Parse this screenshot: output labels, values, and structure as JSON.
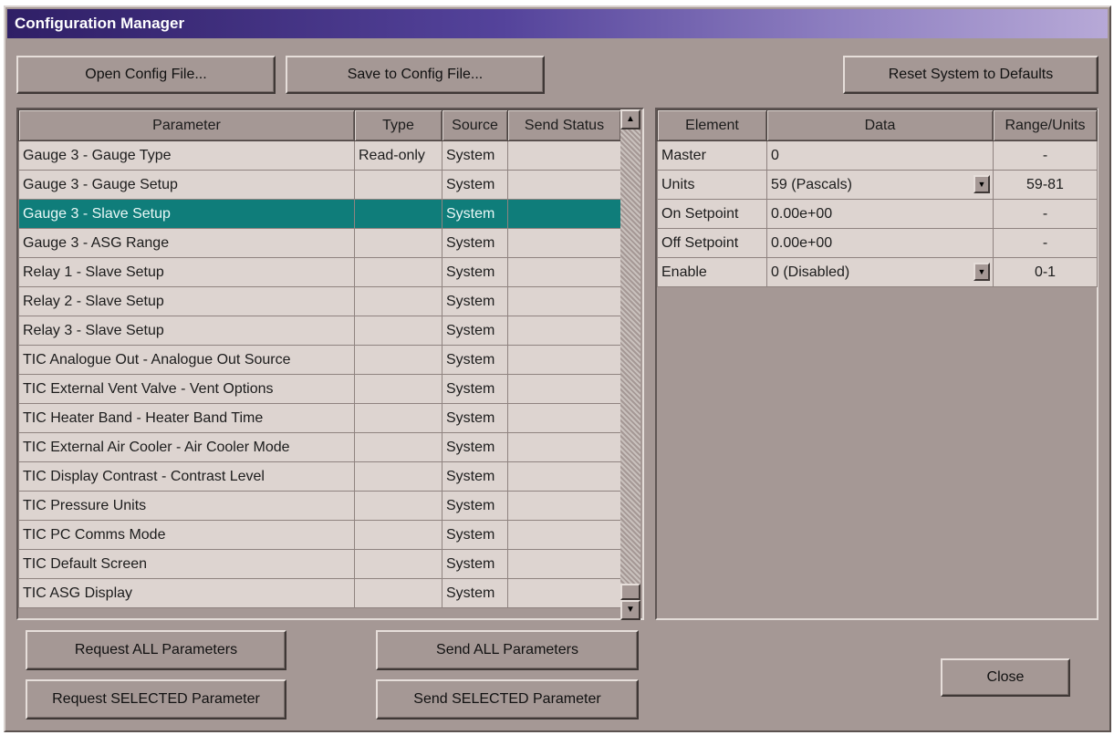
{
  "window": {
    "title": "Configuration Manager"
  },
  "top_buttons": {
    "open": "Open Config File...",
    "save": "Save to Config File...",
    "reset": "Reset System to Defaults"
  },
  "param_table": {
    "headers": [
      "Parameter",
      "Type",
      "Source",
      "Send Status"
    ],
    "selected_index": 2,
    "rows": [
      {
        "parameter": "Gauge 3 - Gauge Type",
        "type": "Read-only",
        "source": "System",
        "status": ""
      },
      {
        "parameter": "Gauge 3 - Gauge Setup",
        "type": "",
        "source": "System",
        "status": ""
      },
      {
        "parameter": "Gauge 3 - Slave Setup",
        "type": "",
        "source": "System",
        "status": ""
      },
      {
        "parameter": "Gauge 3 - ASG Range",
        "type": "",
        "source": "System",
        "status": ""
      },
      {
        "parameter": "Relay 1 - Slave Setup",
        "type": "",
        "source": "System",
        "status": ""
      },
      {
        "parameter": "Relay 2 - Slave Setup",
        "type": "",
        "source": "System",
        "status": ""
      },
      {
        "parameter": "Relay 3 - Slave Setup",
        "type": "",
        "source": "System",
        "status": ""
      },
      {
        "parameter": "TIC Analogue Out - Analogue Out Source",
        "type": "",
        "source": "System",
        "status": ""
      },
      {
        "parameter": "TIC External Vent Valve - Vent Options",
        "type": "",
        "source": "System",
        "status": ""
      },
      {
        "parameter": "TIC Heater Band - Heater Band Time",
        "type": "",
        "source": "System",
        "status": ""
      },
      {
        "parameter": "TIC External Air Cooler - Air Cooler Mode",
        "type": "",
        "source": "System",
        "status": ""
      },
      {
        "parameter": "TIC Display Contrast - Contrast Level",
        "type": "",
        "source": "System",
        "status": ""
      },
      {
        "parameter": "TIC Pressure Units",
        "type": "",
        "source": "System",
        "status": ""
      },
      {
        "parameter": "TIC PC Comms Mode",
        "type": "",
        "source": "System",
        "status": ""
      },
      {
        "parameter": "TIC Default Screen",
        "type": "",
        "source": "System",
        "status": ""
      },
      {
        "parameter": "TIC ASG Display",
        "type": "",
        "source": "System",
        "status": ""
      }
    ]
  },
  "scrollbar": {
    "up_icon": "▲",
    "down_icon": "▼"
  },
  "element_table": {
    "headers": [
      "Element",
      "Data",
      "Range/Units"
    ],
    "rows": [
      {
        "element": "Master",
        "data": "0",
        "range": "-",
        "dropdown": false
      },
      {
        "element": "Units",
        "data": "59 (Pascals)",
        "range": "59-81",
        "dropdown": true
      },
      {
        "element": "On Setpoint",
        "data": "0.00e+00",
        "range": "-",
        "dropdown": false
      },
      {
        "element": "Off Setpoint",
        "data": "0.00e+00",
        "range": "-",
        "dropdown": false
      },
      {
        "element": "Enable",
        "data": "0 (Disabled)",
        "range": "0-1",
        "dropdown": true
      }
    ],
    "dropdown_icon": "▼"
  },
  "bottom_buttons": {
    "request_all": "Request ALL Parameters",
    "request_selected": "Request SELECTED Parameter",
    "send_all": "Send ALL Parameters",
    "send_selected": "Send SELECTED Parameter",
    "close": "Close"
  },
  "colors": {
    "face": "#a59895",
    "cell": "#ddd4d0",
    "selection": "#0f7d7a"
  }
}
